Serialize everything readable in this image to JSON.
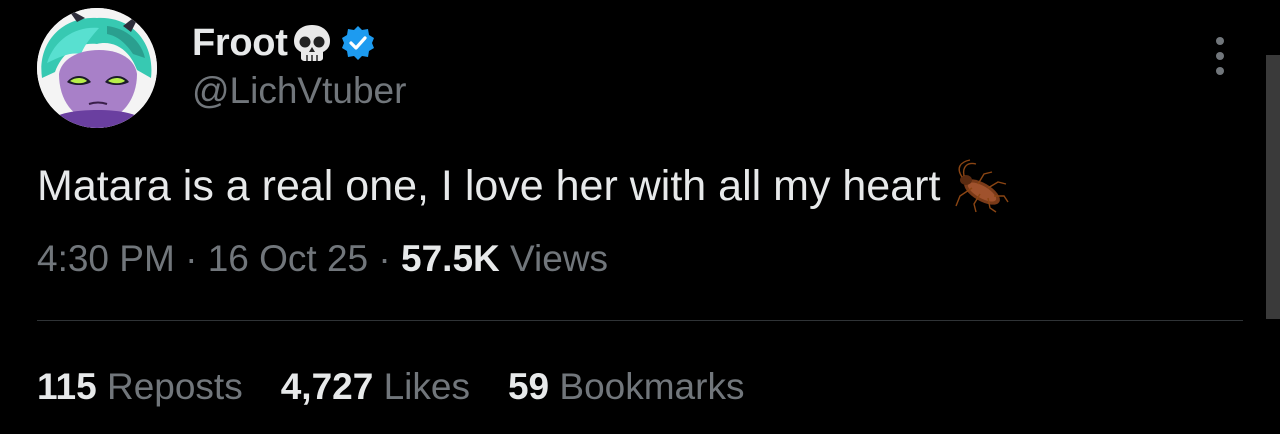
{
  "author": {
    "display_name": "Froot",
    "name_emoji": "skull-icon",
    "verified": true,
    "verified_color": "#1d9bf0",
    "handle": "@LichVtuber"
  },
  "tweet": {
    "text": "Matara is a real one, I love her with all my heart",
    "trailing_emoji": "cockroach-icon"
  },
  "meta": {
    "time": "4:30 PM",
    "sep1": " · ",
    "date": "16 Oct 25",
    "sep2": " · ",
    "views_count": "57.5K",
    "views_label": " Views"
  },
  "stats": {
    "reposts_count": "115",
    "reposts_label": " Reposts",
    "likes_count": "4,727",
    "likes_label": " Likes",
    "bookmarks_count": "59",
    "bookmarks_label": " Bookmarks"
  },
  "colors": {
    "background": "#000000",
    "primary_text": "#e7e9ea",
    "secondary_text": "#71767b",
    "divider": "#2f3336"
  }
}
